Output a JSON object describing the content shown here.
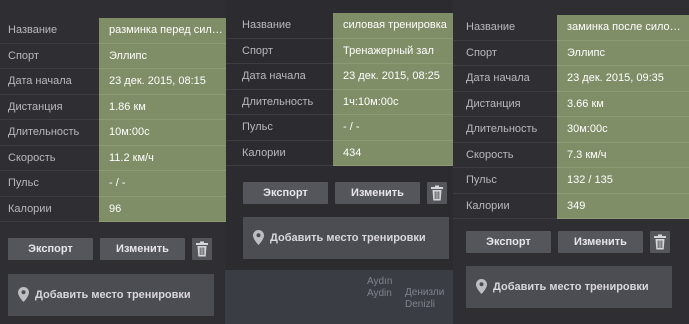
{
  "field_labels": {
    "name": "Название",
    "sport": "Спорт",
    "start_date": "Дата начала",
    "distance": "Дистанция",
    "duration": "Длительность",
    "speed": "Скорость",
    "pulse": "Пульс",
    "calories": "Калории"
  },
  "buttons": {
    "export": "Экспорт",
    "edit": "Изменить",
    "add_place": "Добавить место тренировки"
  },
  "workouts": [
    {
      "name": "разминка перед сил…",
      "sport": "Эллипс",
      "start_date": "23 дек. 2015, 08:15",
      "distance": "1.86 км",
      "duration": "10м:00с",
      "speed": "11.2 км/ч",
      "pulse": "- / -",
      "calories": "96"
    },
    {
      "name": "силовая тренировка",
      "sport": "Тренажерный зал",
      "start_date": "23 дек. 2015, 08:25",
      "duration": "1ч:10м:00с",
      "pulse": "- / -",
      "calories": "434"
    },
    {
      "name": "заминка после сило…",
      "sport": "Эллипс",
      "start_date": "23 дек. 2015, 09:35",
      "distance": "3.66 км",
      "duration": "30м:00с",
      "speed": "7.3 км/ч",
      "pulse": "132 / 135",
      "calories": "349"
    }
  ],
  "map": {
    "city1_a": "Aydın",
    "city1_b": "Aydin",
    "city2_a": "Денизли",
    "city2_b": "Denizli"
  },
  "colors": {
    "value_background": "#7f8e67",
    "button_background": "#55555c",
    "page_background": "#2b2b2f"
  }
}
